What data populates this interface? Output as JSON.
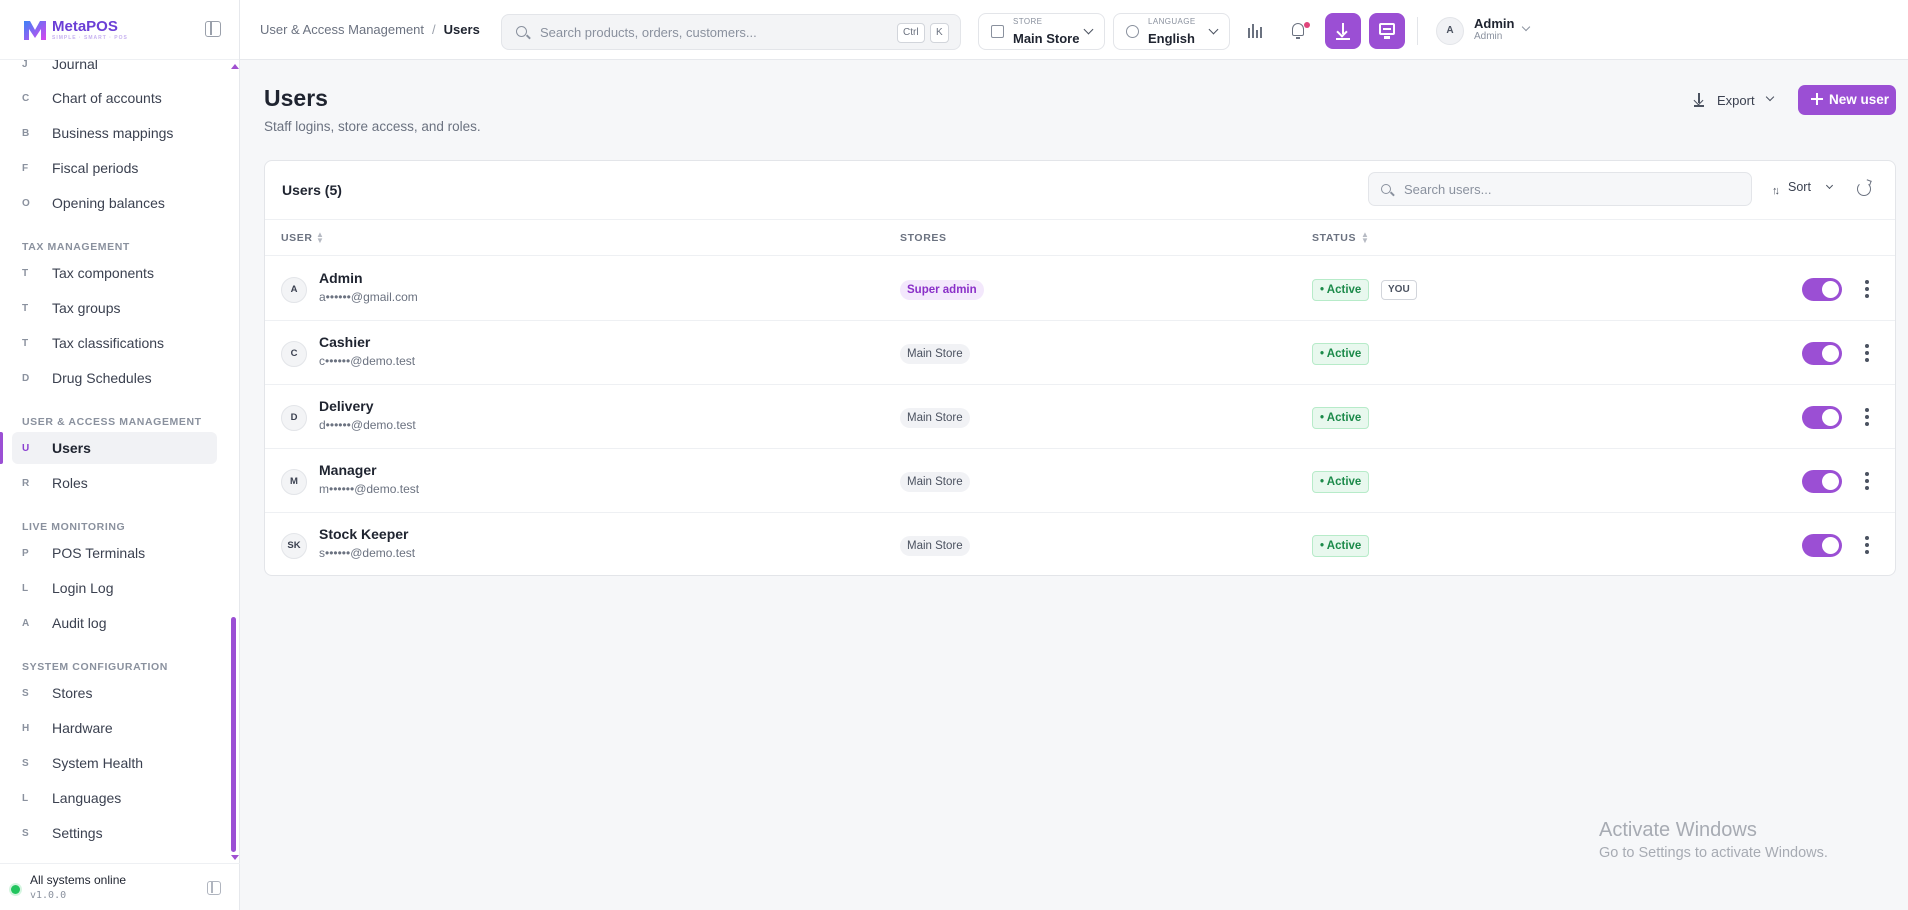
{
  "brand": {
    "name": "MetaPOS",
    "tagline": "SIMPLE · SMART · POS"
  },
  "sidebar": {
    "items_top": [
      {
        "letter": "J",
        "label": "Journal"
      },
      {
        "letter": "C",
        "label": "Chart of accounts"
      },
      {
        "letter": "B",
        "label": "Business mappings"
      },
      {
        "letter": "F",
        "label": "Fiscal periods"
      },
      {
        "letter": "O",
        "label": "Opening balances"
      }
    ],
    "sections": [
      {
        "title": "TAX MANAGEMENT",
        "items": [
          {
            "letter": "T",
            "label": "Tax components"
          },
          {
            "letter": "T",
            "label": "Tax groups"
          },
          {
            "letter": "T",
            "label": "Tax classifications"
          },
          {
            "letter": "D",
            "label": "Drug Schedules"
          }
        ]
      },
      {
        "title": "USER & ACCESS MANAGEMENT",
        "items": [
          {
            "letter": "U",
            "label": "Users"
          },
          {
            "letter": "R",
            "label": "Roles"
          }
        ]
      },
      {
        "title": "LIVE MONITORING",
        "items": [
          {
            "letter": "P",
            "label": "POS Terminals"
          },
          {
            "letter": "L",
            "label": "Login Log"
          },
          {
            "letter": "A",
            "label": "Audit log"
          }
        ]
      },
      {
        "title": "SYSTEM CONFIGURATION",
        "items": [
          {
            "letter": "S",
            "label": "Stores"
          },
          {
            "letter": "H",
            "label": "Hardware"
          },
          {
            "letter": "S",
            "label": "System Health"
          },
          {
            "letter": "L",
            "label": "Languages"
          },
          {
            "letter": "S",
            "label": "Settings"
          }
        ]
      }
    ],
    "active_item": "Users",
    "footer": {
      "status": "All systems online",
      "version": "v1.0.0",
      "status_color": "#22c55e"
    }
  },
  "topbar": {
    "breadcrumb": {
      "parent": "User & Access Management",
      "separator": "/",
      "current": "Users"
    },
    "search": {
      "placeholder": "Search products, orders, customers...",
      "kbd1": "Ctrl",
      "kbd2": "K"
    },
    "store": {
      "title": "STORE",
      "value": "Main Store"
    },
    "language": {
      "title": "LANGUAGE",
      "value": "English"
    },
    "user": {
      "initial": "A",
      "name": "Admin",
      "role": "Admin"
    }
  },
  "page": {
    "title": "Users",
    "subtitle": "Staff logins, store access, and roles.",
    "export_label": "Export",
    "new_user_label": "New user"
  },
  "users_card": {
    "title": "Users (5)",
    "search_placeholder": "Search users...",
    "sort_label": "Sort",
    "columns": [
      "USER",
      "STORES",
      "STATUS"
    ],
    "rows": [
      {
        "initials": "A",
        "name": "Admin",
        "email": "a••••••@gmail.com",
        "store": "Super admin",
        "status": "• Active",
        "badge": "YOU",
        "enabled": true
      },
      {
        "initials": "C",
        "name": "Cashier",
        "email": "c••••••@demo.test",
        "store": "Main Store",
        "status": "• Active",
        "badge": "",
        "enabled": true
      },
      {
        "initials": "D",
        "name": "Delivery",
        "email": "d••••••@demo.test",
        "store": "Main Store",
        "status": "• Active",
        "badge": "",
        "enabled": true
      },
      {
        "initials": "M",
        "name": "Manager",
        "email": "m••••••@demo.test",
        "store": "Main Store",
        "status": "• Active",
        "badge": "",
        "enabled": true
      },
      {
        "initials": "SK",
        "name": "Stock Keeper",
        "email": "s••••••@demo.test",
        "store": "Main Store",
        "status": "• Active",
        "badge": "",
        "enabled": true
      }
    ]
  },
  "watermark": {
    "line1": "Activate Windows",
    "line2": "Go to Settings to activate Windows."
  },
  "colors": {
    "accent": "#9b4fd4",
    "active_status": "#1c8a4a"
  }
}
